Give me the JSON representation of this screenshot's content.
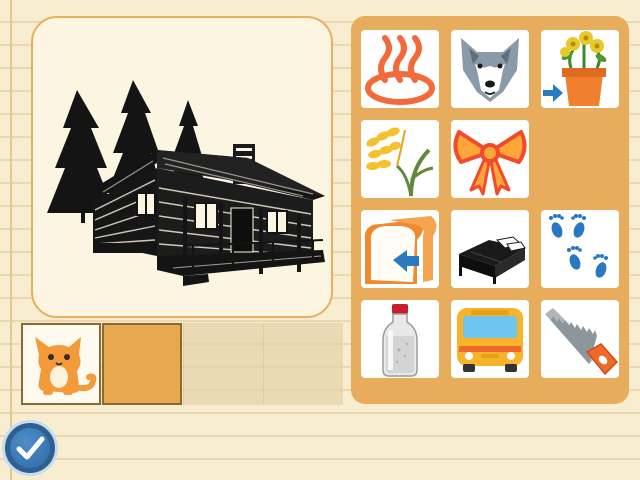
{
  "scene": {
    "main_picture": "log-cabin-with-pine-trees",
    "accent_color": "#e8ad5c",
    "background_color": "#f8edd0"
  },
  "answer_slots": [
    {
      "state": "filled",
      "icon": "cat-icon"
    },
    {
      "state": "active",
      "icon": ""
    },
    {
      "state": "empty",
      "icon": ""
    },
    {
      "state": "empty",
      "icon": ""
    }
  ],
  "choices": [
    {
      "icon": "hot-spring-icon"
    },
    {
      "icon": "wolf-icon"
    },
    {
      "icon": "potted-flowers-arrow-icon"
    },
    {
      "icon": "rice-plant-icon"
    },
    {
      "icon": "ribbon-bow-icon"
    },
    {
      "icon": "bread-slice-arrow-icon"
    },
    {
      "icon": "bed-icon"
    },
    {
      "icon": "footprints-icon"
    },
    {
      "icon": "milk-bottle-icon"
    },
    {
      "icon": "bus-icon"
    },
    {
      "icon": "hand-saw-icon"
    }
  ],
  "controls": {
    "check_button_icon": "checkmark-icon",
    "check_button_color": "#2e5f8e"
  }
}
